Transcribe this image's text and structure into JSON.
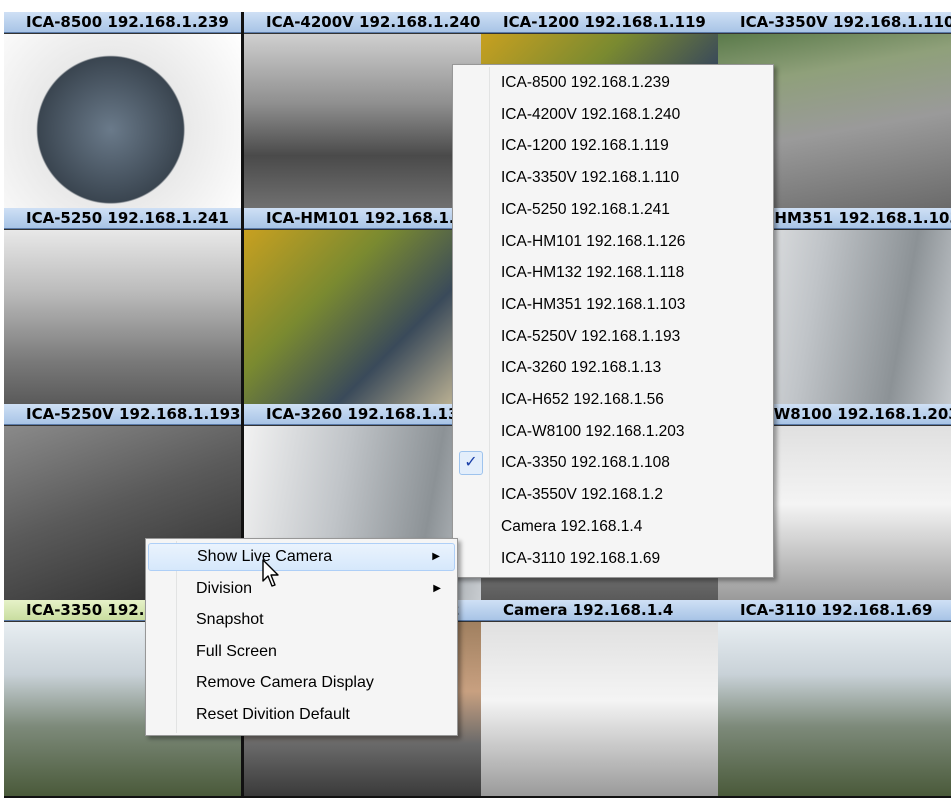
{
  "tiles": [
    {
      "label": "ICA-8500 192.168.1.239"
    },
    {
      "label": "ICA-4200V 192.168.1.240"
    },
    {
      "label": "ICA-1200 192.168.1.119"
    },
    {
      "label": "ICA-3350V 192.168.1.110"
    },
    {
      "label": "ICA-5250 192.168.1.241"
    },
    {
      "label": "ICA-HM101 192.168.1.126"
    },
    {
      "label": "ICA-HM132 192.168.1.118"
    },
    {
      "label": "ICA-HM351 192.168.1.103"
    },
    {
      "label": "ICA-5250V 192.168.1.193"
    },
    {
      "label": "ICA-3260 192.168.1.13"
    },
    {
      "label": "ICA-H652 192.168.1.56"
    },
    {
      "label": "ICA-W8100 192.168.1.203"
    },
    {
      "label": "ICA-3350 192.168.1.108"
    },
    {
      "label": "ICA-3550V 192.168.1.2"
    },
    {
      "label": "Camera 192.168.1.4"
    },
    {
      "label": "ICA-3110 192.168.1.69"
    }
  ],
  "context_menu": {
    "items": [
      {
        "label": "Show Live Camera",
        "submenu": true
      },
      {
        "label": "Division",
        "submenu": true
      },
      {
        "label": "Snapshot"
      },
      {
        "label": "Full Screen"
      },
      {
        "label": "Remove Camera Display"
      },
      {
        "label": "Reset Divition Default"
      }
    ]
  },
  "camera_submenu": {
    "items": [
      {
        "label": "ICA-8500 192.168.1.239"
      },
      {
        "label": "ICA-4200V 192.168.1.240"
      },
      {
        "label": "ICA-1200 192.168.1.119"
      },
      {
        "label": "ICA-3350V 192.168.1.110"
      },
      {
        "label": "ICA-5250 192.168.1.241"
      },
      {
        "label": "ICA-HM101 192.168.1.126"
      },
      {
        "label": "ICA-HM132 192.168.1.118"
      },
      {
        "label": "ICA-HM351 192.168.1.103"
      },
      {
        "label": "ICA-5250V 192.168.1.193"
      },
      {
        "label": "ICA-3260 192.168.1.13"
      },
      {
        "label": "ICA-H652 192.168.1.56"
      },
      {
        "label": "ICA-W8100 192.168.1.203"
      },
      {
        "label": "ICA-3350 192.168.1.108",
        "checked": true
      },
      {
        "label": "ICA-3550V 192.168.1.2"
      },
      {
        "label": "Camera 192.168.1.4"
      },
      {
        "label": "ICA-3110 192.168.1.69"
      }
    ],
    "check_glyph": "✓"
  },
  "submenu_arrow_glyph": "▶",
  "colors": {
    "title_bar": "#a8c4e6",
    "selected_title_bar": "#c9dda0",
    "menu_highlight": "#d6e8fb",
    "check_color": "#1a3fa8"
  }
}
